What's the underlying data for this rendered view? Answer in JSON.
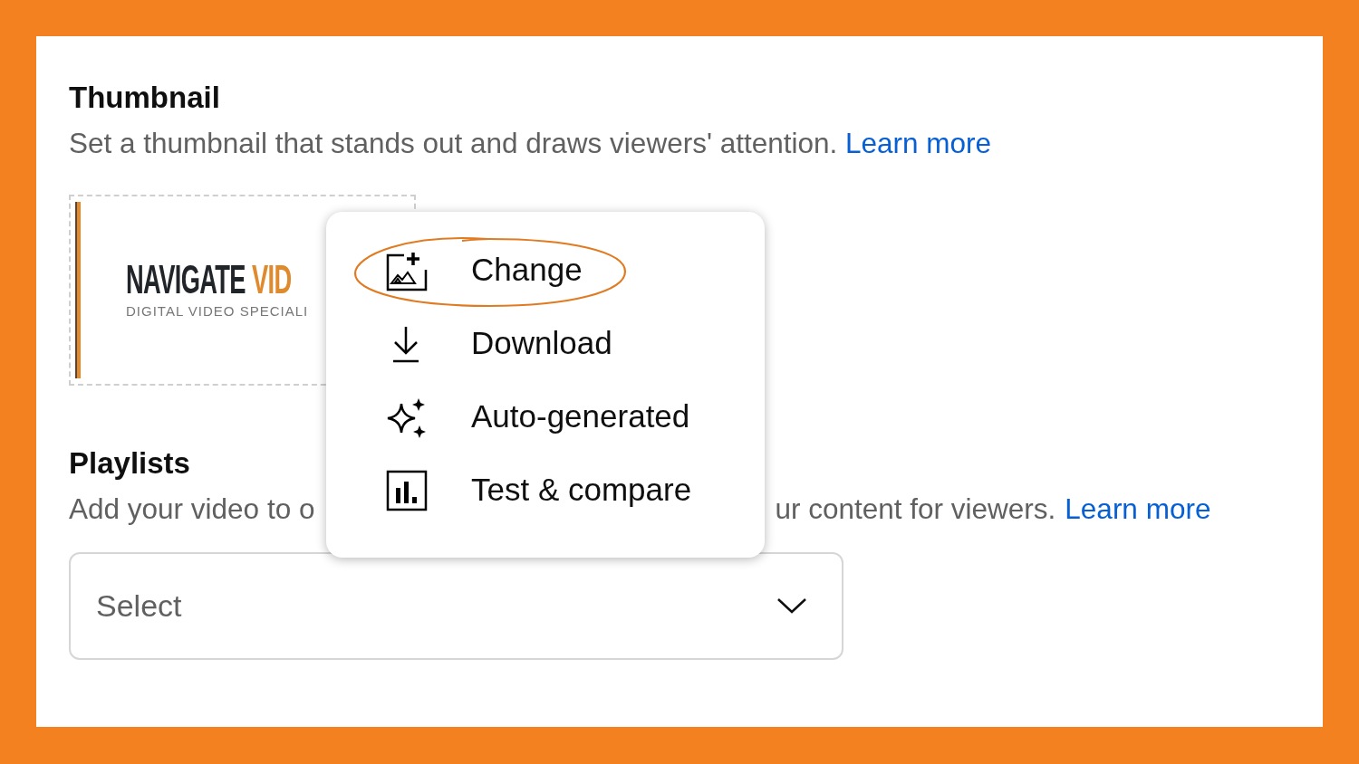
{
  "thumbnail_section": {
    "title": "Thumbnail",
    "description": "Set a thumbnail that stands out and draws viewers' attention.",
    "link": "Learn more",
    "thumbnail": {
      "logo_title": "NAVIGATE",
      "logo_accent": "VID",
      "logo_subtitle": "DIGITAL VIDEO SPECIALI"
    }
  },
  "menu": {
    "items": [
      {
        "kind": "change",
        "label": "Change",
        "highlighted": true
      },
      {
        "kind": "download",
        "label": "Download",
        "highlighted": false
      },
      {
        "kind": "auto",
        "label": "Auto-generated",
        "highlighted": false
      },
      {
        "kind": "test",
        "label": "Test & compare",
        "highlighted": false
      }
    ]
  },
  "playlists_section": {
    "title": "Playlists",
    "description_start": "Add your video to o",
    "description_end": "ur content for viewers.",
    "link": "Learn more",
    "select": {
      "placeholder": "Select"
    }
  }
}
